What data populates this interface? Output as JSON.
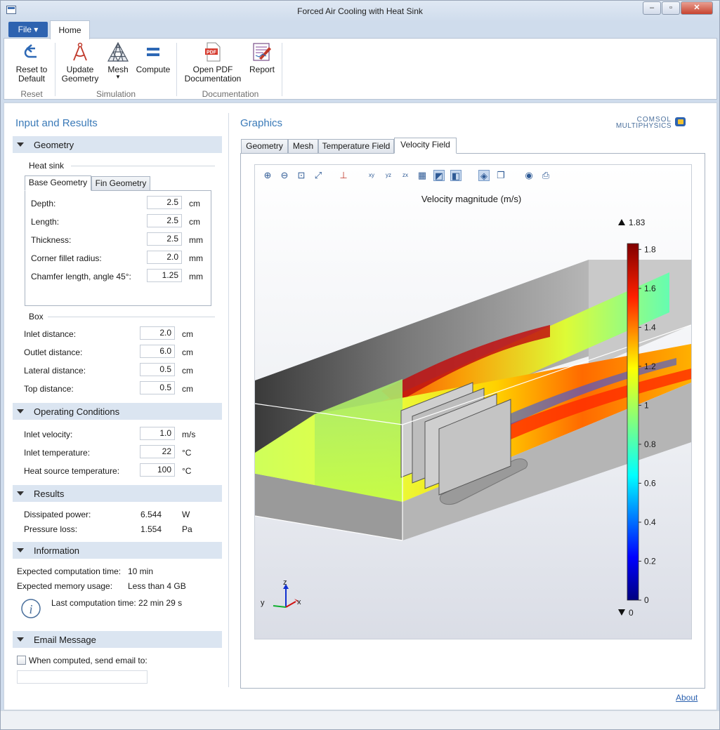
{
  "window": {
    "title": "Forced Air Cooling with Heat Sink",
    "controls": [
      "–",
      "▫",
      "✕"
    ]
  },
  "ribbon": {
    "file_label": "File ▾",
    "home_tab": "Home",
    "buttons": {
      "reset": "Reset to\nDefault",
      "update_geometry": "Update\nGeometry",
      "mesh": "Mesh",
      "compute": "Compute",
      "open_pdf": "Open PDF\nDocumentation",
      "report": "Report"
    },
    "groups": {
      "reset": "Reset",
      "simulation": "Simulation",
      "documentation": "Documentation"
    }
  },
  "left": {
    "title": "Input and Results",
    "geometry": {
      "header": "Geometry",
      "heat_sink": "Heat sink",
      "tabs": [
        "Base Geometry",
        "Fin Geometry"
      ],
      "fields": [
        {
          "label": "Depth:",
          "value": "2.5",
          "unit": "cm"
        },
        {
          "label": "Length:",
          "value": "2.5",
          "unit": "cm"
        },
        {
          "label": "Thickness:",
          "value": "2.5",
          "unit": "mm"
        },
        {
          "label": "Corner fillet radius:",
          "value": "2.0",
          "unit": "mm"
        },
        {
          "label": "Chamfer length, angle 45°:",
          "value": "1.25",
          "unit": "mm"
        }
      ],
      "box": "Box",
      "box_fields": [
        {
          "label": "Inlet distance:",
          "value": "2.0",
          "unit": "cm"
        },
        {
          "label": "Outlet distance:",
          "value": "6.0",
          "unit": "cm"
        },
        {
          "label": "Lateral distance:",
          "value": "0.5",
          "unit": "cm"
        },
        {
          "label": "Top distance:",
          "value": "0.5",
          "unit": "cm"
        }
      ]
    },
    "operating": {
      "header": "Operating Conditions",
      "fields": [
        {
          "label": "Inlet velocity:",
          "value": "1.0",
          "unit": "m/s"
        },
        {
          "label": "Inlet temperature:",
          "value": "22",
          "unit": "°C"
        },
        {
          "label": "Heat source temperature:",
          "value": "100",
          "unit": "°C"
        }
      ]
    },
    "results": {
      "header": "Results",
      "rows": [
        {
          "label": "Dissipated power:",
          "value": "6.544",
          "unit": "W"
        },
        {
          "label": "Pressure loss:",
          "value": "1.554",
          "unit": "Pa"
        }
      ]
    },
    "information": {
      "header": "Information",
      "rows": [
        {
          "label": "Expected computation time:",
          "value": "10 min"
        },
        {
          "label": "Expected memory usage:",
          "value": "Less than 4 GB"
        }
      ],
      "last": "Last computation time: 22 min 29 s"
    },
    "email": {
      "header": "Email Message",
      "checkbox": "When computed, send email to:",
      "checked": false,
      "value": ""
    }
  },
  "graphics": {
    "title": "Graphics",
    "logo_line1": "COMSOL",
    "logo_line2": "MULTIPHYSICS",
    "tabs": [
      "Geometry",
      "Mesh",
      "Temperature Field",
      "Velocity Field"
    ],
    "active_tab": "Velocity Field",
    "toolbar_icons": [
      "zoom-in-icon",
      "zoom-out-icon",
      "zoom-box-icon",
      "zoom-extents-icon",
      "view-axes-icon",
      "xy-view-icon",
      "yz-view-icon",
      "zx-view-icon",
      "grid-icon",
      "scene-light-icon",
      "transparency-icon",
      "lighting-icon",
      "copy-image-icon",
      "camera-icon",
      "print-icon"
    ],
    "plot_title": "Velocity magnitude (m/s)",
    "colorbar": {
      "max_label": "1.83",
      "min_label": "0",
      "ticks": [
        "1.8",
        "1.6",
        "1.4",
        "1.2",
        "1",
        "0.8",
        "0.6",
        "0.4",
        "0.2",
        "0"
      ],
      "tick_values": [
        1.8,
        1.6,
        1.4,
        1.2,
        1.0,
        0.8,
        0.6,
        0.4,
        0.2,
        0.0
      ],
      "range": [
        0,
        1.83
      ]
    },
    "axes": {
      "x": "x",
      "y": "y",
      "z": "z"
    }
  },
  "footer": {
    "about": "About"
  }
}
